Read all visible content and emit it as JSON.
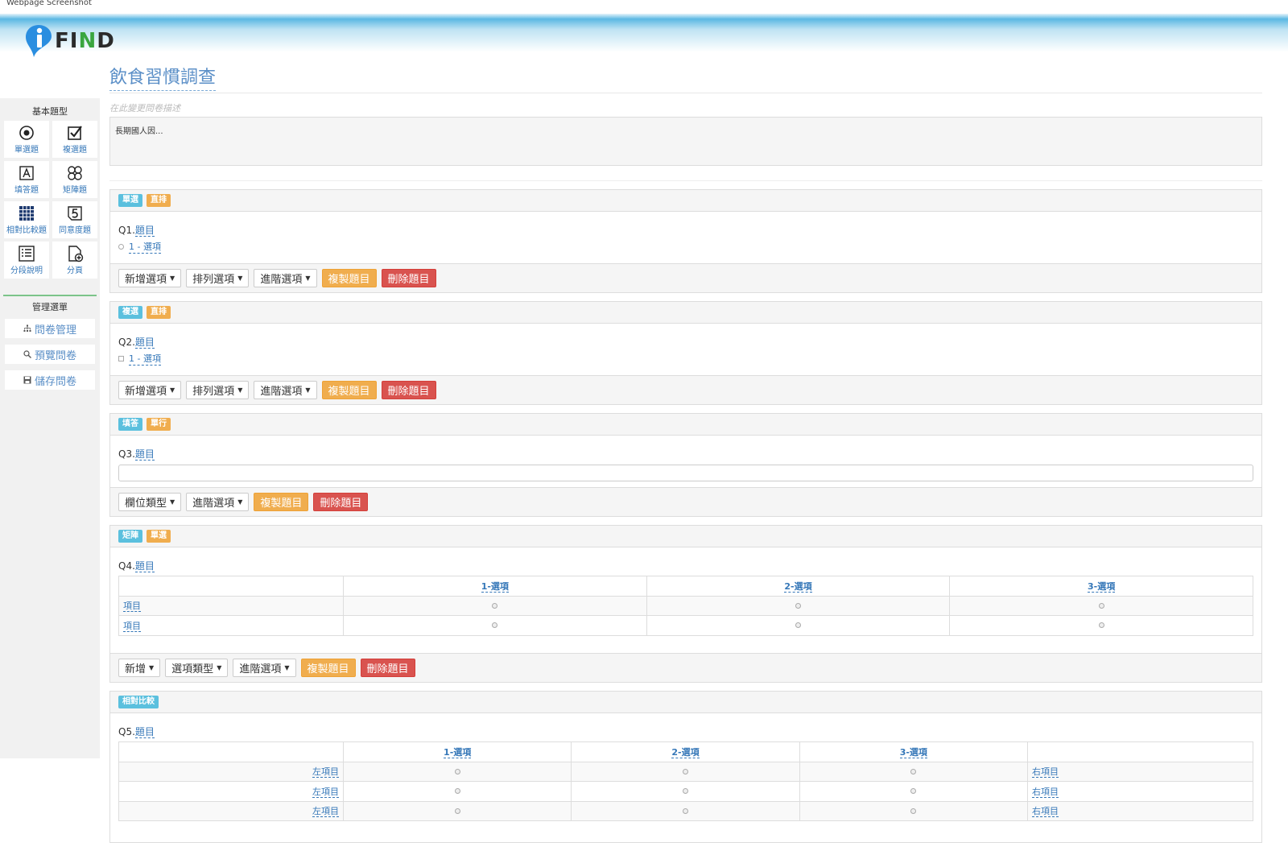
{
  "caption": "Webpage Screenshot",
  "brand": {
    "logo_letter": "i",
    "logo_text_1": "FI",
    "logo_text_2": "N",
    "logo_text_3": "D"
  },
  "sidebar": {
    "basic_title": "基本題型",
    "tools": [
      {
        "label": "單選題",
        "icon": "radio-icon"
      },
      {
        "label": "複選題",
        "icon": "checkbox-icon"
      },
      {
        "label": "填答題",
        "icon": "text-answer-icon"
      },
      {
        "label": "矩陣題",
        "icon": "matrix-icon"
      },
      {
        "label": "相對比較題",
        "icon": "grid-icon"
      },
      {
        "label": "同意度題",
        "icon": "scale-five-icon"
      },
      {
        "label": "分段說明",
        "icon": "list-icon"
      },
      {
        "label": "分頁",
        "icon": "add-page-icon"
      }
    ],
    "mgmt_title": "管理選單",
    "mgmt": [
      {
        "label": "問卷管理",
        "icon": "sitemap-icon"
      },
      {
        "label": "預覽問卷",
        "icon": "search-icon"
      },
      {
        "label": "儲存問卷",
        "icon": "floppy-icon"
      }
    ]
  },
  "survey": {
    "title": "飲食習慣調查",
    "desc_placeholder": "在此變更問卷描述",
    "desc_value": "長期國人因..."
  },
  "common": {
    "add_option": "新增選項",
    "sort_option": "排列選項",
    "adv_option": "進階選項",
    "copy": "複製題目",
    "delete": "刪除題目",
    "field_type": "欄位類型",
    "add": "新增",
    "option_type": "選項類型",
    "item": "項目",
    "left_item": "左項目",
    "right_item": "右項目"
  },
  "questions": [
    {
      "num": "Q1.",
      "title": "題目",
      "tag1": "單選",
      "tag2": "直排",
      "option": "1 - 選項"
    },
    {
      "num": "Q2.",
      "title": "題目",
      "tag1": "複選",
      "tag2": "直排",
      "option": "1 - 選項"
    },
    {
      "num": "Q3.",
      "title": "題目",
      "tag1": "填答",
      "tag2": "單行"
    },
    {
      "num": "Q4.",
      "title": "題目",
      "tag1": "矩陣",
      "tag2": "單選",
      "cols": [
        "1-選項",
        "2-選項",
        "3-選項"
      ]
    },
    {
      "num": "Q5.",
      "title": "題目",
      "tag1": "相對比較",
      "cols": [
        "1-選項",
        "2-選項",
        "3-選項"
      ]
    }
  ]
}
